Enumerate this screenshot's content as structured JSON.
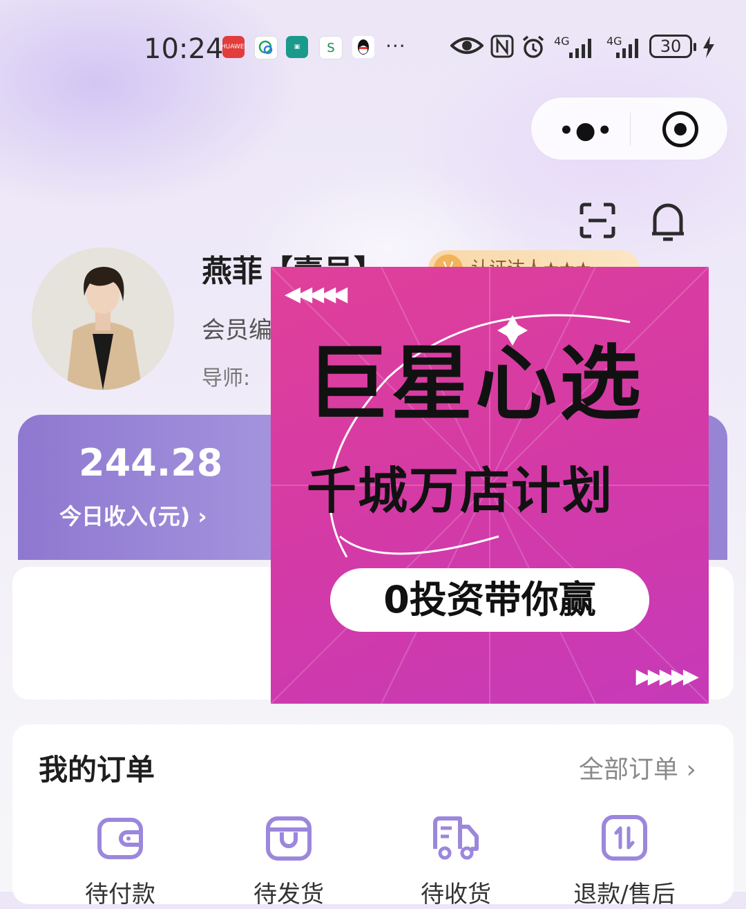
{
  "status_bar": {
    "time": "10:24",
    "app_icons": [
      "HUAWEI",
      "chat-icon",
      "bank-icon",
      "metro-icon",
      "qq-icon"
    ],
    "more_dots": "···",
    "signal_1": "4G",
    "signal_2": "4G",
    "battery": "30"
  },
  "capsule": {
    "more_label": "•●•"
  },
  "profile": {
    "name": "燕菲【壹号】",
    "badge": "认证达人★★★",
    "member_no": "会员编",
    "mentor": "导师:"
  },
  "income": {
    "value": "244.28",
    "label": "今日收入(元) ›"
  },
  "ad": {
    "arrows_left": "◀◀◀◀◀",
    "arrows_right": "▶▶▶▶▶",
    "title": "巨星心选",
    "subtitle": "千城万店计划",
    "pill": "0投资带你赢"
  },
  "orders": {
    "title": "我的订单",
    "all_label": "全部订单 ›",
    "items": [
      {
        "label": "待付款"
      },
      {
        "label": "待发货"
      },
      {
        "label": "待收货"
      },
      {
        "label": "退款/售后"
      }
    ]
  },
  "colors": {
    "accent": "#8e78d0",
    "icon_purple": "#9b87dc",
    "ad_pink": "#d43aa6"
  }
}
